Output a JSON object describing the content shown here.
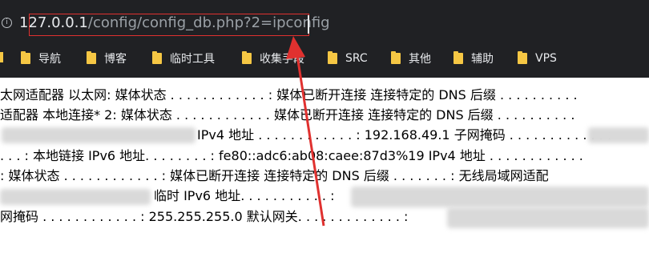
{
  "browser": {
    "url_host": "127.0.0.1",
    "url_path": "/config/config_db.php?2=ipconfig"
  },
  "bookmarks": [
    {
      "label": "导航"
    },
    {
      "label": "博客"
    },
    {
      "label": "临时工具"
    },
    {
      "label": "收集手段"
    },
    {
      "label": "SRC"
    },
    {
      "label": "其他"
    },
    {
      "label": "辅助"
    },
    {
      "label": "VPS"
    }
  ],
  "output_lines": [
    "太网适配器 以太网: 媒体状态 . . . . . . . . . . . . : 媒体已断开连接 连接特定的 DNS 后缀 . . . . . . . . . .",
    "适配器 本地连接* 2: 媒体状态 . . . . . . . . . . . . 媒体已断开连接 连接特定的 DNS 后缀 . . . . . . . . . .",
    "IPv4 地址 . . . . . . . . . . . . : 192.168.49.1 子网掩码 . . . . . . . . . . . . :",
    ". . . : 本地链接 IPv6 地址. . . . . . . . : fe80::adc6:ab08:caee:87d3%19 IPv4 地址 . . . . . . . . . . . .",
    ": 媒体状态 . . . . . . . . . . . . : 媒体已断开连接 连接特定的 DNS 后缀 . . . . . . . : 无线局域网适配",
    "临时 IPv6 地址. . . . . . . . . . . :",
    "网掩码 . . . . . . . . . . . . : 255.255.255.0 默认网关. . . . . . . . . . . . . :"
  ]
}
